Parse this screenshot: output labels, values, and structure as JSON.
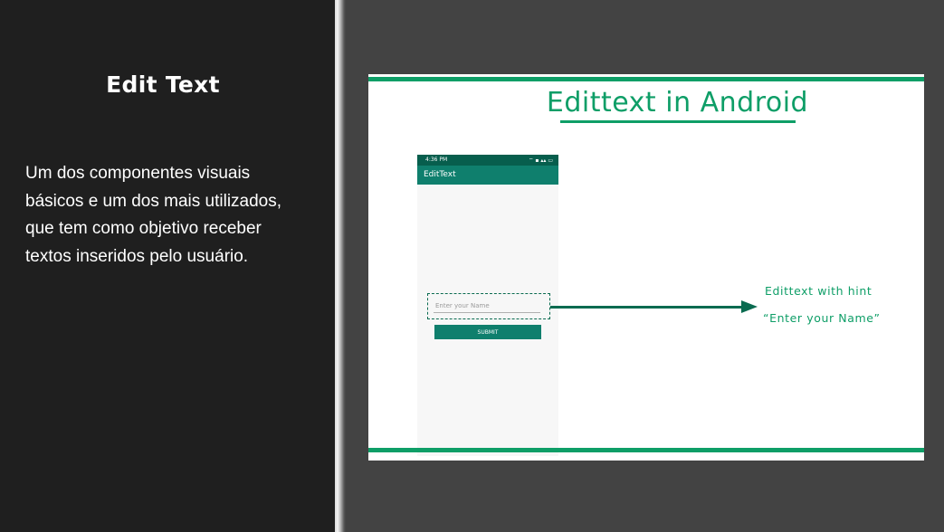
{
  "left_panel": {
    "title": "Edit Text",
    "body_lines": [
      "Um dos componentes visuais",
      "básicos e um dos mais utilizados,",
      "que tem como objetivo receber",
      "textos inseridos pelo usuário."
    ]
  },
  "slide": {
    "title": "Edittext in Android",
    "phone": {
      "status_time": "4:36 PM",
      "status_icons": "⌔ ▪ ▴▴ ▭",
      "app_title": "EditText",
      "edit_hint": "Enter your Name",
      "submit_label": "SUBMIT"
    },
    "callout": {
      "line1": "Edittext with hint",
      "line2": "“Enter your Name”"
    }
  },
  "colors": {
    "accent_green": "#0e9e67",
    "app_teal": "#0f7f6d",
    "panel_dark": "#1f1f1f",
    "background_gray": "#434343"
  }
}
